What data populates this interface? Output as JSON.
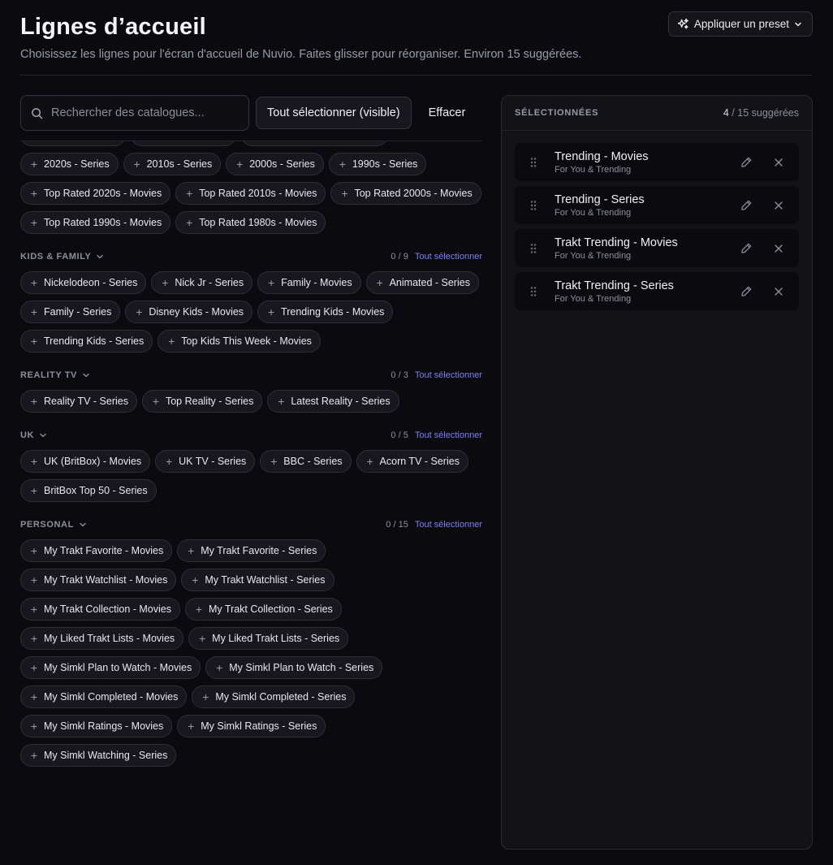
{
  "header": {
    "title": "Lignes d’accueil",
    "subtitle": "Choisissez les lignes pour l'écran d'accueil de Nuvio. Faites glisser pour réorganiser. Environ 15 suggérées.",
    "preset_label": "Appliquer un preset"
  },
  "toolbar": {
    "search_placeholder": "Rechercher des catalogues...",
    "select_all_visible": "Tout sélectionner (visible)",
    "clear": "Effacer"
  },
  "decades": {
    "chips": [
      "2020s - Series",
      "2010s - Series",
      "2000s - Series",
      "1990s - Series",
      "Top Rated 2020s - Movies",
      "Top Rated 2010s - Movies",
      "Top Rated 2000s - Movies",
      "Top Rated 1990s - Movies",
      "Top Rated 1980s - Movies"
    ]
  },
  "sections": {
    "select_all_label": "Tout sélectionner",
    "kids": {
      "title": "KIDS & FAMILY",
      "count": "0 / 9",
      "chips": [
        "Nickelodeon - Series",
        "Nick Jr - Series",
        "Family - Movies",
        "Animated - Series",
        "Family - Series",
        "Disney Kids - Movies",
        "Trending Kids - Movies",
        "Trending Kids - Series",
        "Top Kids This Week - Movies"
      ]
    },
    "reality": {
      "title": "REALITY TV",
      "count": "0 / 3",
      "chips": [
        "Reality TV - Series",
        "Top Reality - Series",
        "Latest Reality - Series"
      ]
    },
    "uk": {
      "title": "UK",
      "count": "0 / 5",
      "chips": [
        "UK (BritBox) - Movies",
        "UK TV - Series",
        "BBC - Series",
        "Acorn TV - Series",
        "BritBox Top 50 - Series"
      ]
    },
    "personal": {
      "title": "PERSONAL",
      "count": "0 / 15",
      "chips": [
        "My Trakt Favorite - Movies",
        "My Trakt Favorite - Series",
        "My Trakt Watchlist - Movies",
        "My Trakt Watchlist - Series",
        "My Trakt Collection - Movies",
        "My Trakt Collection - Series",
        "My Liked Trakt Lists - Movies",
        "My Liked Trakt Lists - Series",
        "My Simkl Plan to Watch - Movies",
        "My Simkl Plan to Watch - Series",
        "My Simkl Completed - Movies",
        "My Simkl Completed - Series",
        "My Simkl Ratings - Movies",
        "My Simkl Ratings - Series",
        "My Simkl Watching - Series"
      ]
    }
  },
  "panel": {
    "title": "SÉLECTIONNÉES",
    "selected_count": "4",
    "suggested_text": " / 15 suggérées",
    "items": [
      {
        "name": "Trending - Movies",
        "group": "For You & Trending"
      },
      {
        "name": "Trending - Series",
        "group": "For You & Trending"
      },
      {
        "name": "Trakt Trending - Movies",
        "group": "For You & Trending"
      },
      {
        "name": "Trakt Trending - Series",
        "group": "For You & Trending"
      }
    ]
  },
  "icons": {
    "preset": "sparkles-icon",
    "search": "search-icon",
    "chevron": "chevron-down-icon",
    "plus": "plus-icon",
    "grip": "drag-handle-icon",
    "edit": "pencil-icon",
    "remove": "close-icon"
  },
  "colors": {
    "background": "#0b0b0f",
    "panel": "#121217",
    "accent_link": "#7b7ff5"
  }
}
